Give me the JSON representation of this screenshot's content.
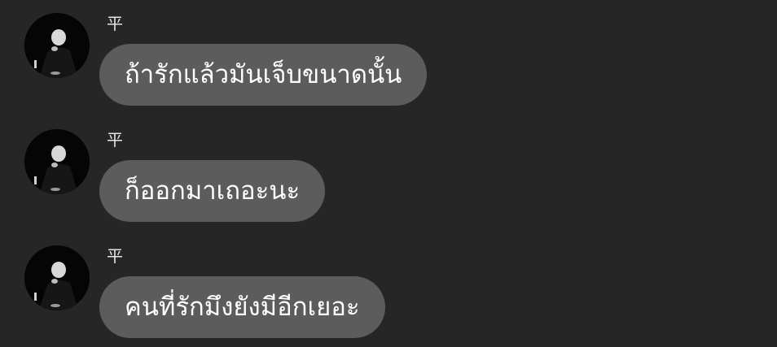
{
  "messages": [
    {
      "sender": "平",
      "text": "ถ้ารักแล้วมันเจ็บขนาดนั้น",
      "avatar_icon": "profile-photo-icon"
    },
    {
      "sender": "平",
      "text": "ก็ออกมาเถอะนะ",
      "avatar_icon": "profile-photo-icon"
    },
    {
      "sender": "平",
      "text": "คนที่รักมึงยังมีอีกเยอะ",
      "avatar_icon": "profile-photo-icon"
    }
  ],
  "colors": {
    "background": "#262626",
    "bubble": "#5c5c5c",
    "text": "#ffffff",
    "avatar_bg": "#050505"
  }
}
